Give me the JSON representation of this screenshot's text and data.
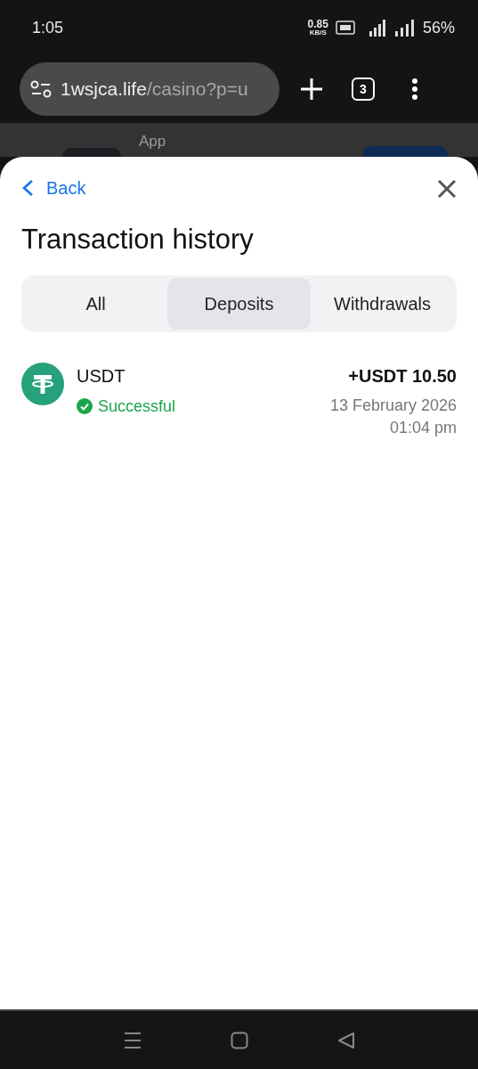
{
  "status_bar": {
    "time": "1:05",
    "net_speed": "0.85",
    "net_unit": "KB/S",
    "battery": "56%"
  },
  "browser": {
    "url_host": "1wsjca.life",
    "url_path": "/casino?p=u",
    "tab_count": "3"
  },
  "background_page": {
    "label": "App"
  },
  "sheet": {
    "back": "Back",
    "title": "Transaction history",
    "tabs": [
      {
        "label": "All",
        "selected": false
      },
      {
        "label": "Deposits",
        "selected": true
      },
      {
        "label": "Withdrawals",
        "selected": false
      }
    ],
    "transactions": [
      {
        "currency": "USDT",
        "status": "Successful",
        "success": true,
        "amount": "+USDT 10.50",
        "date": "13 February 2026",
        "time": "01:04 pm"
      }
    ]
  }
}
